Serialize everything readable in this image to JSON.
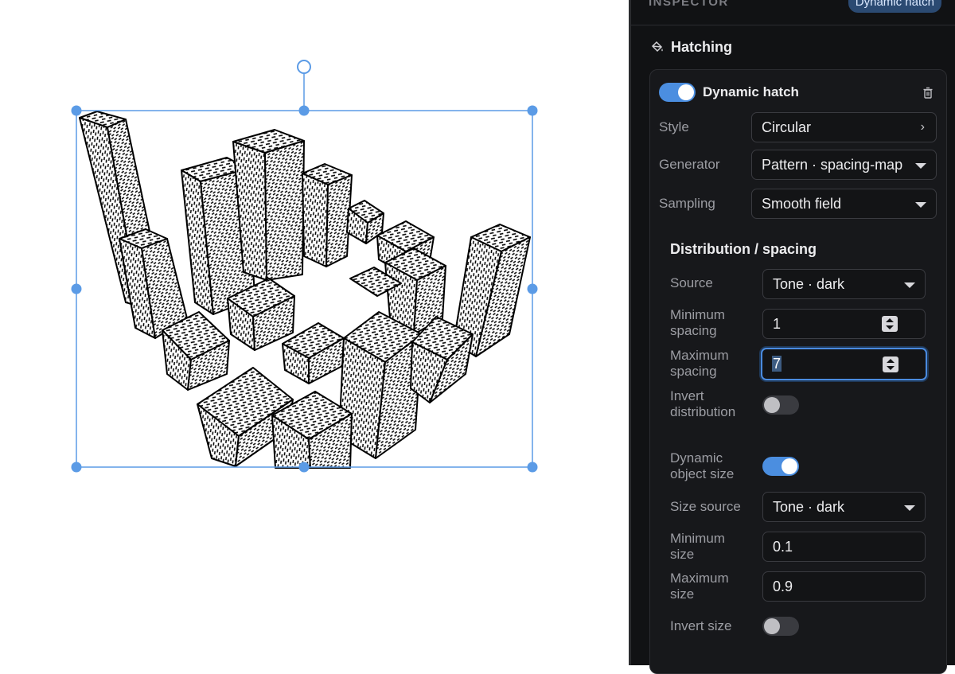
{
  "inspector": {
    "title": "INSPECTOR",
    "mode_badge": "Dynamic hatch",
    "section_title": "Hatching",
    "section_icon": "paint-bucket-icon"
  },
  "hatch": {
    "toggle_label": "Dynamic hatch",
    "enabled": true,
    "style_label": "Style",
    "style_value": "Circular",
    "generator_label": "Generator",
    "generator_value": "Pattern · spacing-map",
    "sampling_label": "Sampling",
    "sampling_value": "Smooth field"
  },
  "distribution": {
    "heading": "Distribution / spacing",
    "source_label": "Source",
    "source_value": "Tone · dark",
    "min_spacing_label_1": "Minimum",
    "min_spacing_label_2": "spacing",
    "min_spacing_value": "1",
    "max_spacing_label_1": "Maximum",
    "max_spacing_label_2": "spacing",
    "max_spacing_value": "7",
    "invert_label_1": "Invert",
    "invert_label_2": "distribution",
    "invert_enabled": false
  },
  "object_size": {
    "dynamic_label_1": "Dynamic",
    "dynamic_label_2": "object size",
    "dynamic_enabled": true,
    "size_source_label": "Size source",
    "size_source_value": "Tone · dark",
    "min_size_label_1": "Minimum",
    "min_size_label_2": "size",
    "min_size_value": "0.1",
    "max_size_label_1": "Maximum",
    "max_size_label_2": "size",
    "max_size_value": "0.9",
    "invert_size_label": "Invert size",
    "invert_size_enabled": false
  },
  "colors": {
    "accent": "#4b8ee0",
    "selection": "#5b9be6",
    "panel_bg": "#111214",
    "badge_bg": "#2b4a72"
  }
}
